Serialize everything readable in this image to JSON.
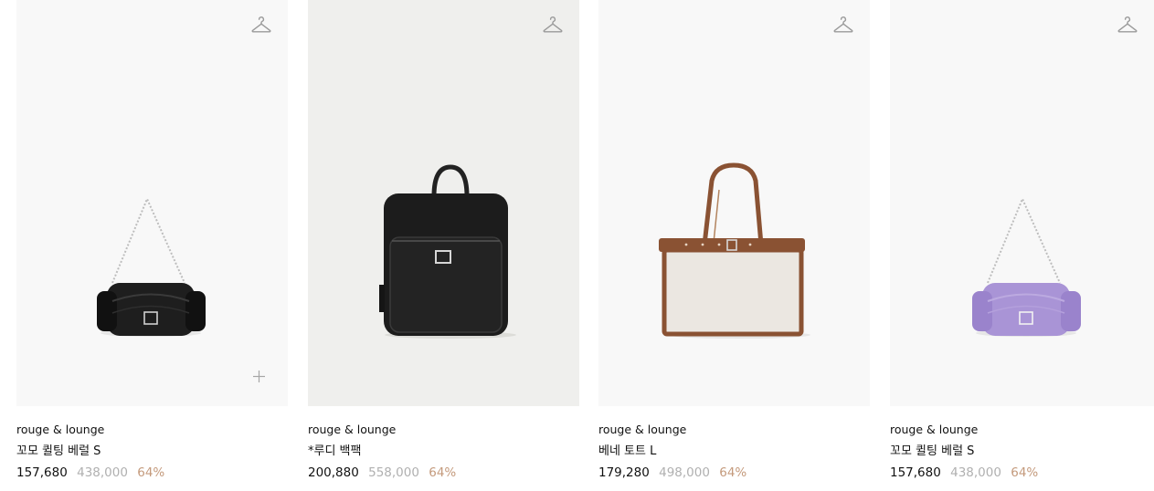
{
  "products": [
    {
      "brand": "rouge & lounge",
      "name": "꼬모 퀼팅 베럴 S",
      "price": "157,680",
      "original_price": "438,000",
      "discount": "64%",
      "bag_color": "black"
    },
    {
      "brand": "rouge & lounge",
      "name": "*루디 백팩",
      "price": "200,880",
      "original_price": "558,000",
      "discount": "64%",
      "bag_color": "black"
    },
    {
      "brand": "rouge & lounge",
      "name": "베네 토트 L",
      "price": "179,280",
      "original_price": "498,000",
      "discount": "64%",
      "bag_color": "canvas-brown"
    },
    {
      "brand": "rouge & lounge",
      "name": "꼬모 퀼팅 베럴 S",
      "price": "157,680",
      "original_price": "438,000",
      "discount": "64%",
      "bag_color": "lavender"
    }
  ],
  "icons": {
    "wishlist": "hanger-icon",
    "quick_add": "plus-icon"
  },
  "colors": {
    "price": "#111111",
    "original_price": "#b0b0b0",
    "discount": "#c49a7c",
    "thumb_bg": "#f8f8f8",
    "thumb_bg_alt": "#efefed"
  }
}
